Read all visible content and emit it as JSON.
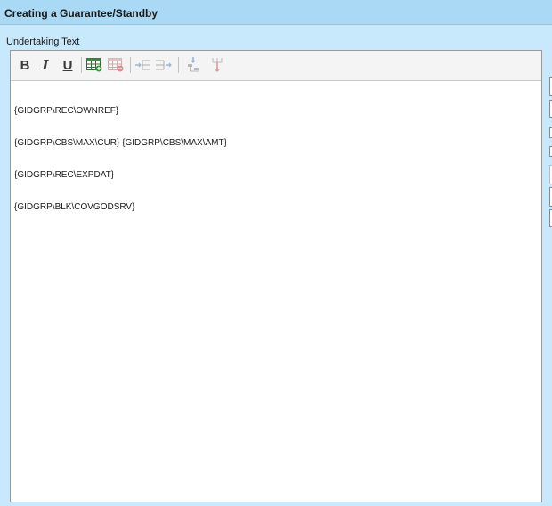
{
  "window": {
    "title": "Creating a Guarantee/Standby"
  },
  "form": {
    "field_label": "Undertaking Text"
  },
  "toolbar": {
    "bold": "B",
    "italic": "I",
    "underline": "U",
    "icons": [
      "insert-table-icon",
      "delete-table-icon",
      "indent-icon",
      "outdent-icon",
      "merge-icon",
      "split-icon"
    ]
  },
  "editor": {
    "lines": [
      "{GIDGRP\\REC\\OWNREF}",
      "{GIDGRP\\CBS\\MAX\\CUR} {GIDGRP\\CBS\\MAX\\AMT}",
      "{GIDGRP\\REC\\EXPDAT}",
      "{GIDGRP\\BLK\\COVGODSRV}"
    ]
  },
  "colors": {
    "background": "#c8e8fb",
    "titlebar": "#a9d9f5"
  }
}
